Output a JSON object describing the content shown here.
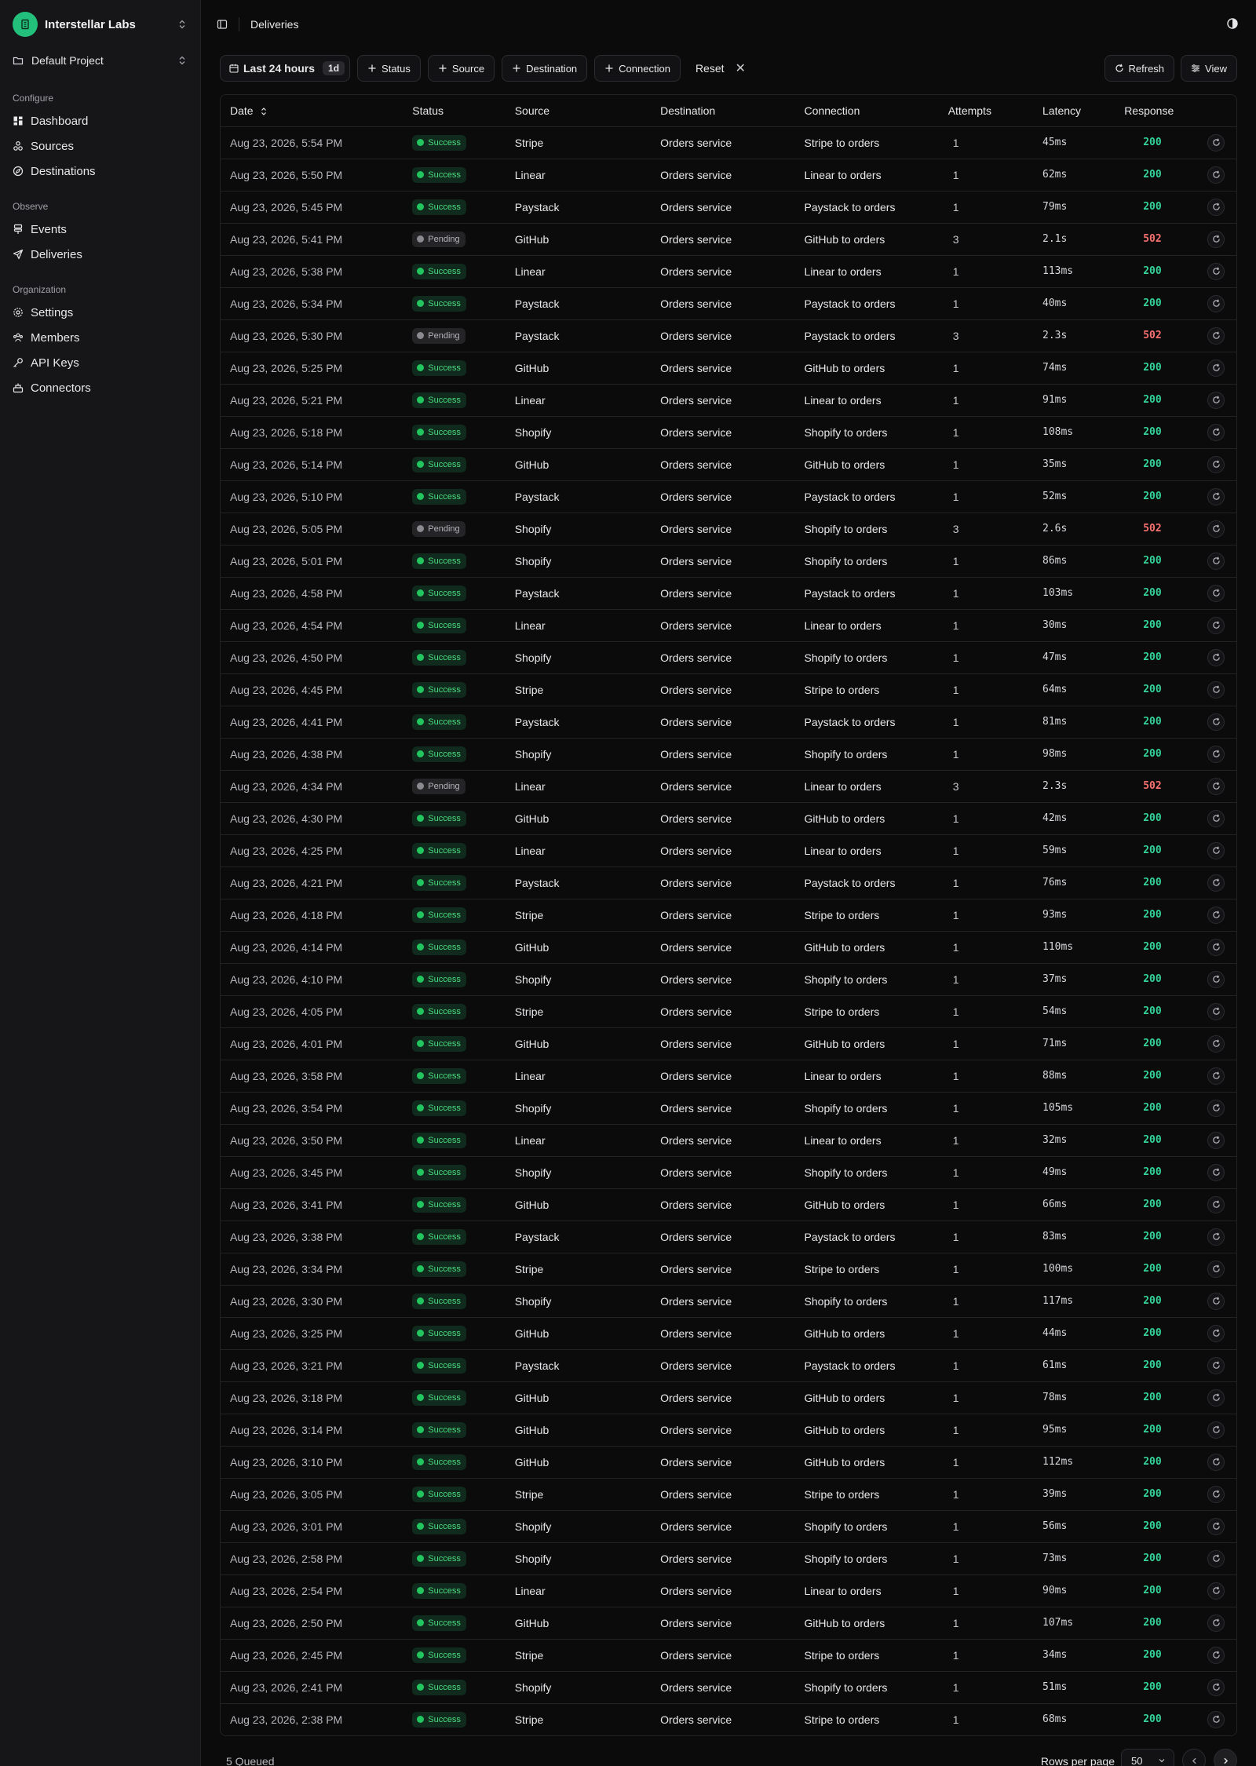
{
  "org": {
    "name": "Interstellar Labs"
  },
  "project": {
    "name": "Default Project"
  },
  "sidebar": {
    "sections": [
      {
        "title": "Configure",
        "items": [
          {
            "label": "Dashboard",
            "icon": "dashboard-icon"
          },
          {
            "label": "Sources",
            "icon": "sources-icon"
          },
          {
            "label": "Destinations",
            "icon": "destinations-icon"
          }
        ]
      },
      {
        "title": "Observe",
        "items": [
          {
            "label": "Events",
            "icon": "events-icon"
          },
          {
            "label": "Deliveries",
            "icon": "deliveries-icon"
          }
        ]
      },
      {
        "title": "Organization",
        "items": [
          {
            "label": "Settings",
            "icon": "gear-icon"
          },
          {
            "label": "Members",
            "icon": "members-icon"
          },
          {
            "label": "API Keys",
            "icon": "key-icon"
          },
          {
            "label": "Connectors",
            "icon": "connectors-icon"
          }
        ]
      }
    ]
  },
  "header": {
    "title": "Deliveries"
  },
  "filters": {
    "date_range": "Last 24 hours",
    "date_badge": "1d",
    "chips": [
      "Status",
      "Source",
      "Destination",
      "Connection"
    ],
    "reset": "Reset",
    "refresh": "Refresh",
    "view": "View"
  },
  "table": {
    "columns": [
      "Date",
      "Status",
      "Source",
      "Destination",
      "Connection",
      "Attempts",
      "Latency",
      "Response"
    ],
    "rows": [
      [
        "Aug 23, 2026, 5:54 PM",
        "Success",
        "Stripe",
        "Orders service",
        "Stripe to orders",
        "1",
        "45ms",
        "200"
      ],
      [
        "Aug 23, 2026, 5:50 PM",
        "Success",
        "Linear",
        "Orders service",
        "Linear to orders",
        "1",
        "62ms",
        "200"
      ],
      [
        "Aug 23, 2026, 5:45 PM",
        "Success",
        "Paystack",
        "Orders service",
        "Paystack to orders",
        "1",
        "79ms",
        "200"
      ],
      [
        "Aug 23, 2026, 5:41 PM",
        "Pending",
        "GitHub",
        "Orders service",
        "GitHub to orders",
        "3",
        "2.1s",
        "502"
      ],
      [
        "Aug 23, 2026, 5:38 PM",
        "Success",
        "Linear",
        "Orders service",
        "Linear to orders",
        "1",
        "113ms",
        "200"
      ],
      [
        "Aug 23, 2026, 5:34 PM",
        "Success",
        "Paystack",
        "Orders service",
        "Paystack to orders",
        "1",
        "40ms",
        "200"
      ],
      [
        "Aug 23, 2026, 5:30 PM",
        "Pending",
        "Paystack",
        "Orders service",
        "Paystack to orders",
        "3",
        "2.3s",
        "502"
      ],
      [
        "Aug 23, 2026, 5:25 PM",
        "Success",
        "GitHub",
        "Orders service",
        "GitHub to orders",
        "1",
        "74ms",
        "200"
      ],
      [
        "Aug 23, 2026, 5:21 PM",
        "Success",
        "Linear",
        "Orders service",
        "Linear to orders",
        "1",
        "91ms",
        "200"
      ],
      [
        "Aug 23, 2026, 5:18 PM",
        "Success",
        "Shopify",
        "Orders service",
        "Shopify to orders",
        "1",
        "108ms",
        "200"
      ],
      [
        "Aug 23, 2026, 5:14 PM",
        "Success",
        "GitHub",
        "Orders service",
        "GitHub to orders",
        "1",
        "35ms",
        "200"
      ],
      [
        "Aug 23, 2026, 5:10 PM",
        "Success",
        "Paystack",
        "Orders service",
        "Paystack to orders",
        "1",
        "52ms",
        "200"
      ],
      [
        "Aug 23, 2026, 5:05 PM",
        "Pending",
        "Shopify",
        "Orders service",
        "Shopify to orders",
        "3",
        "2.6s",
        "502"
      ],
      [
        "Aug 23, 2026, 5:01 PM",
        "Success",
        "Shopify",
        "Orders service",
        "Shopify to orders",
        "1",
        "86ms",
        "200"
      ],
      [
        "Aug 23, 2026, 4:58 PM",
        "Success",
        "Paystack",
        "Orders service",
        "Paystack to orders",
        "1",
        "103ms",
        "200"
      ],
      [
        "Aug 23, 2026, 4:54 PM",
        "Success",
        "Linear",
        "Orders service",
        "Linear to orders",
        "1",
        "30ms",
        "200"
      ],
      [
        "Aug 23, 2026, 4:50 PM",
        "Success",
        "Shopify",
        "Orders service",
        "Shopify to orders",
        "1",
        "47ms",
        "200"
      ],
      [
        "Aug 23, 2026, 4:45 PM",
        "Success",
        "Stripe",
        "Orders service",
        "Stripe to orders",
        "1",
        "64ms",
        "200"
      ],
      [
        "Aug 23, 2026, 4:41 PM",
        "Success",
        "Paystack",
        "Orders service",
        "Paystack to orders",
        "1",
        "81ms",
        "200"
      ],
      [
        "Aug 23, 2026, 4:38 PM",
        "Success",
        "Shopify",
        "Orders service",
        "Shopify to orders",
        "1",
        "98ms",
        "200"
      ],
      [
        "Aug 23, 2026, 4:34 PM",
        "Pending",
        "Linear",
        "Orders service",
        "Linear to orders",
        "3",
        "2.3s",
        "502"
      ],
      [
        "Aug 23, 2026, 4:30 PM",
        "Success",
        "GitHub",
        "Orders service",
        "GitHub to orders",
        "1",
        "42ms",
        "200"
      ],
      [
        "Aug 23, 2026, 4:25 PM",
        "Success",
        "Linear",
        "Orders service",
        "Linear to orders",
        "1",
        "59ms",
        "200"
      ],
      [
        "Aug 23, 2026, 4:21 PM",
        "Success",
        "Paystack",
        "Orders service",
        "Paystack to orders",
        "1",
        "76ms",
        "200"
      ],
      [
        "Aug 23, 2026, 4:18 PM",
        "Success",
        "Stripe",
        "Orders service",
        "Stripe to orders",
        "1",
        "93ms",
        "200"
      ],
      [
        "Aug 23, 2026, 4:14 PM",
        "Success",
        "GitHub",
        "Orders service",
        "GitHub to orders",
        "1",
        "110ms",
        "200"
      ],
      [
        "Aug 23, 2026, 4:10 PM",
        "Success",
        "Shopify",
        "Orders service",
        "Shopify to orders",
        "1",
        "37ms",
        "200"
      ],
      [
        "Aug 23, 2026, 4:05 PM",
        "Success",
        "Stripe",
        "Orders service",
        "Stripe to orders",
        "1",
        "54ms",
        "200"
      ],
      [
        "Aug 23, 2026, 4:01 PM",
        "Success",
        "GitHub",
        "Orders service",
        "GitHub to orders",
        "1",
        "71ms",
        "200"
      ],
      [
        "Aug 23, 2026, 3:58 PM",
        "Success",
        "Linear",
        "Orders service",
        "Linear to orders",
        "1",
        "88ms",
        "200"
      ],
      [
        "Aug 23, 2026, 3:54 PM",
        "Success",
        "Shopify",
        "Orders service",
        "Shopify to orders",
        "1",
        "105ms",
        "200"
      ],
      [
        "Aug 23, 2026, 3:50 PM",
        "Success",
        "Linear",
        "Orders service",
        "Linear to orders",
        "1",
        "32ms",
        "200"
      ],
      [
        "Aug 23, 2026, 3:45 PM",
        "Success",
        "Shopify",
        "Orders service",
        "Shopify to orders",
        "1",
        "49ms",
        "200"
      ],
      [
        "Aug 23, 2026, 3:41 PM",
        "Success",
        "GitHub",
        "Orders service",
        "GitHub to orders",
        "1",
        "66ms",
        "200"
      ],
      [
        "Aug 23, 2026, 3:38 PM",
        "Success",
        "Paystack",
        "Orders service",
        "Paystack to orders",
        "1",
        "83ms",
        "200"
      ],
      [
        "Aug 23, 2026, 3:34 PM",
        "Success",
        "Stripe",
        "Orders service",
        "Stripe to orders",
        "1",
        "100ms",
        "200"
      ],
      [
        "Aug 23, 2026, 3:30 PM",
        "Success",
        "Shopify",
        "Orders service",
        "Shopify to orders",
        "1",
        "117ms",
        "200"
      ],
      [
        "Aug 23, 2026, 3:25 PM",
        "Success",
        "GitHub",
        "Orders service",
        "GitHub to orders",
        "1",
        "44ms",
        "200"
      ],
      [
        "Aug 23, 2026, 3:21 PM",
        "Success",
        "Paystack",
        "Orders service",
        "Paystack to orders",
        "1",
        "61ms",
        "200"
      ],
      [
        "Aug 23, 2026, 3:18 PM",
        "Success",
        "GitHub",
        "Orders service",
        "GitHub to orders",
        "1",
        "78ms",
        "200"
      ],
      [
        "Aug 23, 2026, 3:14 PM",
        "Success",
        "GitHub",
        "Orders service",
        "GitHub to orders",
        "1",
        "95ms",
        "200"
      ],
      [
        "Aug 23, 2026, 3:10 PM",
        "Success",
        "GitHub",
        "Orders service",
        "GitHub to orders",
        "1",
        "112ms",
        "200"
      ],
      [
        "Aug 23, 2026, 3:05 PM",
        "Success",
        "Stripe",
        "Orders service",
        "Stripe to orders",
        "1",
        "39ms",
        "200"
      ],
      [
        "Aug 23, 2026, 3:01 PM",
        "Success",
        "Shopify",
        "Orders service",
        "Shopify to orders",
        "1",
        "56ms",
        "200"
      ],
      [
        "Aug 23, 2026, 2:58 PM",
        "Success",
        "Shopify",
        "Orders service",
        "Shopify to orders",
        "1",
        "73ms",
        "200"
      ],
      [
        "Aug 23, 2026, 2:54 PM",
        "Success",
        "Linear",
        "Orders service",
        "Linear to orders",
        "1",
        "90ms",
        "200"
      ],
      [
        "Aug 23, 2026, 2:50 PM",
        "Success",
        "GitHub",
        "Orders service",
        "GitHub to orders",
        "1",
        "107ms",
        "200"
      ],
      [
        "Aug 23, 2026, 2:45 PM",
        "Success",
        "Stripe",
        "Orders service",
        "Stripe to orders",
        "1",
        "34ms",
        "200"
      ],
      [
        "Aug 23, 2026, 2:41 PM",
        "Success",
        "Shopify",
        "Orders service",
        "Shopify to orders",
        "1",
        "51ms",
        "200"
      ],
      [
        "Aug 23, 2026, 2:38 PM",
        "Success",
        "Stripe",
        "Orders service",
        "Stripe to orders",
        "1",
        "68ms",
        "200"
      ]
    ]
  },
  "footer": {
    "queued": "5 Queued",
    "rows_per_page_label": "Rows per page",
    "rows_per_page": "50"
  },
  "colors": {
    "accent": "#22c07a",
    "success": "#34d399",
    "error": "#f87171",
    "background": "#0b0b0c",
    "sidebar": "#161618"
  }
}
